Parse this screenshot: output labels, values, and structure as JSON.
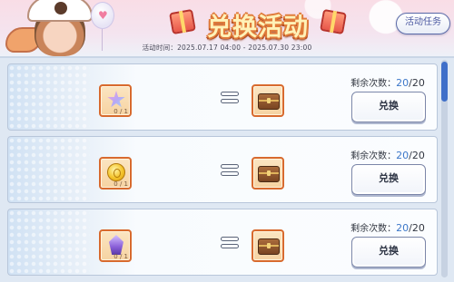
{
  "header": {
    "title": "兑换活动",
    "time_label": "活动时间：",
    "time_range": "2025.07.17 04:00 - 2025.07.30 23:00",
    "task_button": "活动任务"
  },
  "rows": [
    {
      "input_item": "star-crystal-icon",
      "input_count": "0 / 1",
      "output_item": "treasure-chest-icon",
      "remaining_label": "剩余次数：",
      "remaining": "20",
      "total": "/20",
      "button": "兑换"
    },
    {
      "input_item": "gold-coin-icon",
      "input_count": "0 / 1",
      "output_item": "treasure-chest-icon",
      "remaining_label": "剩余次数：",
      "remaining": "20",
      "total": "/20",
      "button": "兑换"
    },
    {
      "input_item": "purple-gem-icon",
      "input_count": "0 / 1",
      "output_item": "treasure-chest-icon",
      "remaining_label": "剩余次数：",
      "remaining": "20",
      "total": "/20",
      "button": "兑换"
    }
  ],
  "colors": {
    "accent_blue": "#3d78c9",
    "slot_border": "#d86a2e",
    "title_fill": "#fff2b8"
  }
}
